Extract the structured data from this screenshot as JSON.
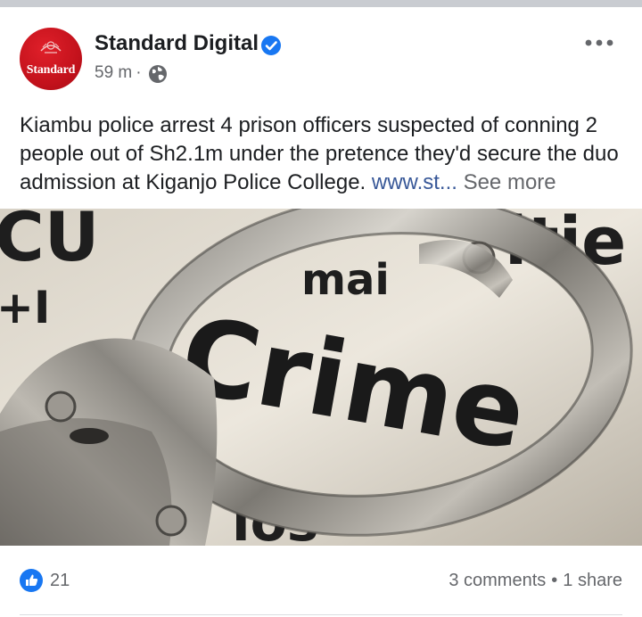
{
  "post": {
    "page_name": "Standard Digital",
    "avatar_text": "Standard",
    "time": "59 m",
    "separator": "·",
    "audience_icon": "globe-icon",
    "verified_icon": "verified-badge-icon",
    "more_icon": "more-options-icon",
    "caption": "Kiambu police arrest 4 prison officers suspected of conning 2 people out of Sh2.1m under the pretence they'd secure the duo admission at Kiganjo Police College.",
    "link_text": "www.st...",
    "see_more": "See more",
    "image": {
      "word": "Crime",
      "bg_text_left": "CU",
      "bg_text_left2": "+I",
      "bg_text_right": "itie",
      "bg_text_top": "mai",
      "bg_text_bottom": "los"
    }
  },
  "stats": {
    "reaction_icon": "like-icon",
    "like_count": "21",
    "comments": "3 comments",
    "bullet": "•",
    "shares": "1 share"
  },
  "colors": {
    "brand_red": "#c4121c",
    "verified_blue": "#1877f2",
    "link_blue": "#385898",
    "secondary_text": "#65676b"
  }
}
